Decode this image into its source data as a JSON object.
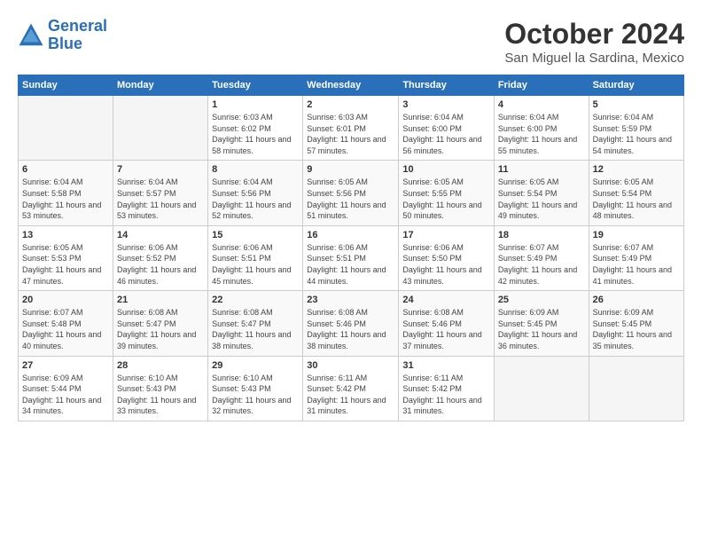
{
  "header": {
    "logo_line1": "General",
    "logo_line2": "Blue",
    "month_title": "October 2024",
    "location": "San Miguel la Sardina, Mexico"
  },
  "weekdays": [
    "Sunday",
    "Monday",
    "Tuesday",
    "Wednesday",
    "Thursday",
    "Friday",
    "Saturday"
  ],
  "weeks": [
    [
      {
        "day": "",
        "info": ""
      },
      {
        "day": "",
        "info": ""
      },
      {
        "day": "1",
        "info": "Sunrise: 6:03 AM\nSunset: 6:02 PM\nDaylight: 11 hours and 58 minutes."
      },
      {
        "day": "2",
        "info": "Sunrise: 6:03 AM\nSunset: 6:01 PM\nDaylight: 11 hours and 57 minutes."
      },
      {
        "day": "3",
        "info": "Sunrise: 6:04 AM\nSunset: 6:00 PM\nDaylight: 11 hours and 56 minutes."
      },
      {
        "day": "4",
        "info": "Sunrise: 6:04 AM\nSunset: 6:00 PM\nDaylight: 11 hours and 55 minutes."
      },
      {
        "day": "5",
        "info": "Sunrise: 6:04 AM\nSunset: 5:59 PM\nDaylight: 11 hours and 54 minutes."
      }
    ],
    [
      {
        "day": "6",
        "info": "Sunrise: 6:04 AM\nSunset: 5:58 PM\nDaylight: 11 hours and 53 minutes."
      },
      {
        "day": "7",
        "info": "Sunrise: 6:04 AM\nSunset: 5:57 PM\nDaylight: 11 hours and 53 minutes."
      },
      {
        "day": "8",
        "info": "Sunrise: 6:04 AM\nSunset: 5:56 PM\nDaylight: 11 hours and 52 minutes."
      },
      {
        "day": "9",
        "info": "Sunrise: 6:05 AM\nSunset: 5:56 PM\nDaylight: 11 hours and 51 minutes."
      },
      {
        "day": "10",
        "info": "Sunrise: 6:05 AM\nSunset: 5:55 PM\nDaylight: 11 hours and 50 minutes."
      },
      {
        "day": "11",
        "info": "Sunrise: 6:05 AM\nSunset: 5:54 PM\nDaylight: 11 hours and 49 minutes."
      },
      {
        "day": "12",
        "info": "Sunrise: 6:05 AM\nSunset: 5:54 PM\nDaylight: 11 hours and 48 minutes."
      }
    ],
    [
      {
        "day": "13",
        "info": "Sunrise: 6:05 AM\nSunset: 5:53 PM\nDaylight: 11 hours and 47 minutes."
      },
      {
        "day": "14",
        "info": "Sunrise: 6:06 AM\nSunset: 5:52 PM\nDaylight: 11 hours and 46 minutes."
      },
      {
        "day": "15",
        "info": "Sunrise: 6:06 AM\nSunset: 5:51 PM\nDaylight: 11 hours and 45 minutes."
      },
      {
        "day": "16",
        "info": "Sunrise: 6:06 AM\nSunset: 5:51 PM\nDaylight: 11 hours and 44 minutes."
      },
      {
        "day": "17",
        "info": "Sunrise: 6:06 AM\nSunset: 5:50 PM\nDaylight: 11 hours and 43 minutes."
      },
      {
        "day": "18",
        "info": "Sunrise: 6:07 AM\nSunset: 5:49 PM\nDaylight: 11 hours and 42 minutes."
      },
      {
        "day": "19",
        "info": "Sunrise: 6:07 AM\nSunset: 5:49 PM\nDaylight: 11 hours and 41 minutes."
      }
    ],
    [
      {
        "day": "20",
        "info": "Sunrise: 6:07 AM\nSunset: 5:48 PM\nDaylight: 11 hours and 40 minutes."
      },
      {
        "day": "21",
        "info": "Sunrise: 6:08 AM\nSunset: 5:47 PM\nDaylight: 11 hours and 39 minutes."
      },
      {
        "day": "22",
        "info": "Sunrise: 6:08 AM\nSunset: 5:47 PM\nDaylight: 11 hours and 38 minutes."
      },
      {
        "day": "23",
        "info": "Sunrise: 6:08 AM\nSunset: 5:46 PM\nDaylight: 11 hours and 38 minutes."
      },
      {
        "day": "24",
        "info": "Sunrise: 6:08 AM\nSunset: 5:46 PM\nDaylight: 11 hours and 37 minutes."
      },
      {
        "day": "25",
        "info": "Sunrise: 6:09 AM\nSunset: 5:45 PM\nDaylight: 11 hours and 36 minutes."
      },
      {
        "day": "26",
        "info": "Sunrise: 6:09 AM\nSunset: 5:45 PM\nDaylight: 11 hours and 35 minutes."
      }
    ],
    [
      {
        "day": "27",
        "info": "Sunrise: 6:09 AM\nSunset: 5:44 PM\nDaylight: 11 hours and 34 minutes."
      },
      {
        "day": "28",
        "info": "Sunrise: 6:10 AM\nSunset: 5:43 PM\nDaylight: 11 hours and 33 minutes."
      },
      {
        "day": "29",
        "info": "Sunrise: 6:10 AM\nSunset: 5:43 PM\nDaylight: 11 hours and 32 minutes."
      },
      {
        "day": "30",
        "info": "Sunrise: 6:11 AM\nSunset: 5:42 PM\nDaylight: 11 hours and 31 minutes."
      },
      {
        "day": "31",
        "info": "Sunrise: 6:11 AM\nSunset: 5:42 PM\nDaylight: 11 hours and 31 minutes."
      },
      {
        "day": "",
        "info": ""
      },
      {
        "day": "",
        "info": ""
      }
    ]
  ]
}
